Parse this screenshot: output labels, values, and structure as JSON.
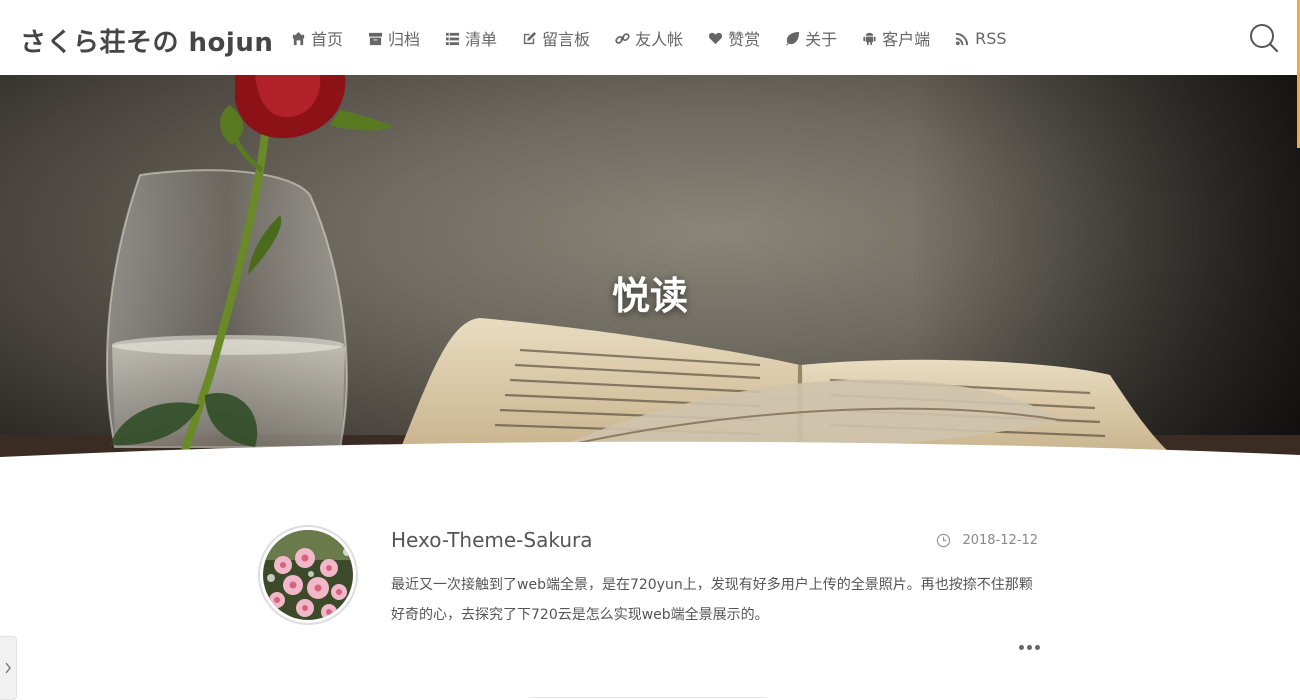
{
  "site": {
    "title": "さくら荘その hojun"
  },
  "nav": {
    "items": [
      {
        "label": "首页",
        "icon": "home-icon"
      },
      {
        "label": "归档",
        "icon": "archive-icon"
      },
      {
        "label": "清单",
        "icon": "list-icon"
      },
      {
        "label": "留言板",
        "icon": "edit-icon"
      },
      {
        "label": "友人帐",
        "icon": "link-icon"
      },
      {
        "label": "赞赏",
        "icon": "heart-icon"
      },
      {
        "label": "关于",
        "icon": "leaf-icon"
      },
      {
        "label": "客户端",
        "icon": "android-icon"
      },
      {
        "label": "RSS",
        "icon": "rss-icon"
      }
    ]
  },
  "hero": {
    "title": "悦读"
  },
  "post": {
    "title": "Hexo-Theme-Sakura",
    "date": "2018-12-12",
    "excerpt": "最近又一次接触到了web端全景，是在720yun上，发现有好多用户上传的全景照片。再也按捺不住那颗好奇的心，去探究了下720云是怎么实现web端全景展示的。"
  },
  "colors": {
    "accent": "#f4a93b",
    "text": "#555555"
  }
}
